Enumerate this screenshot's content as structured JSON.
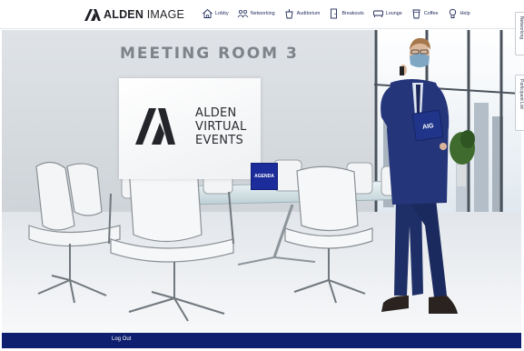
{
  "header": {
    "logo_bold": "ALDEN",
    "logo_light": "IMAGE",
    "nav": [
      {
        "label": "Lobby",
        "icon": "house-icon"
      },
      {
        "label": "Networking",
        "icon": "people-icon"
      },
      {
        "label": "Auditorium",
        "icon": "podium-icon"
      },
      {
        "label": "Breakouts",
        "icon": "door-icon"
      },
      {
        "label": "Lounge",
        "icon": "sofa-icon"
      },
      {
        "label": "Coffee",
        "icon": "coffee-cup-icon"
      },
      {
        "label": "Help",
        "icon": "lightbulb-icon"
      }
    ]
  },
  "scene": {
    "room_title": "MEETING ROOM 3",
    "screen": {
      "line1": "ALDEN",
      "line2": "VIRTUAL",
      "line3": "EVENTS"
    },
    "agenda_label": "AGENDA",
    "folder_label": "AIG"
  },
  "side_tabs": {
    "networking": "Networking",
    "participant_list": "Participant List"
  },
  "footer": {
    "logout_label": "Log Out"
  },
  "colors": {
    "nav_text": "#1f2a5a",
    "footer_bg": "#0d1f6e",
    "agenda_bg": "#1c2c9a",
    "suit": "#1e2e66"
  }
}
